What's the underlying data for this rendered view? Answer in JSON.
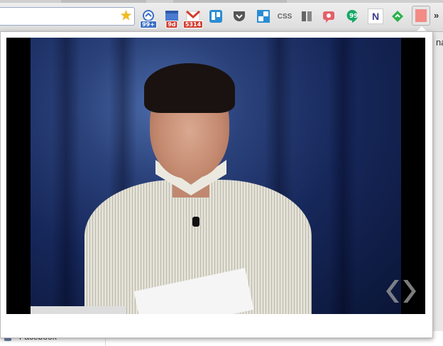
{
  "toolbar": {
    "extensions": [
      {
        "name": "share-icon",
        "badge": "99+",
        "badge_color": "#3b6fc4"
      },
      {
        "name": "calendar-icon",
        "badge": "9d",
        "badge_color": "#d33c2e"
      },
      {
        "name": "gmail-icon",
        "badge": "5314",
        "badge_color": "#d33c2e"
      },
      {
        "name": "trello-icon",
        "badge": ""
      },
      {
        "name": "pocket-icon",
        "badge": ""
      },
      {
        "name": "layout-icon",
        "badge": ""
      },
      {
        "name": "css-icon",
        "label": "CSS"
      },
      {
        "name": "reader-icon",
        "badge": ""
      },
      {
        "name": "record-icon",
        "badge": ""
      },
      {
        "name": "hangouts-icon",
        "badge": ""
      },
      {
        "name": "notion-icon",
        "label": "N"
      },
      {
        "name": "feedly-icon",
        "badge": ""
      },
      {
        "name": "active-extension-icon",
        "badge": ""
      }
    ],
    "overflow_label": "»"
  },
  "bookmarks": {
    "facebook_label": "Facebook"
  },
  "page": {
    "right_edge_text": "na"
  },
  "colors": {
    "accent": "#f3bb1b",
    "video_background": "#000000",
    "curtain": "#16275a"
  }
}
